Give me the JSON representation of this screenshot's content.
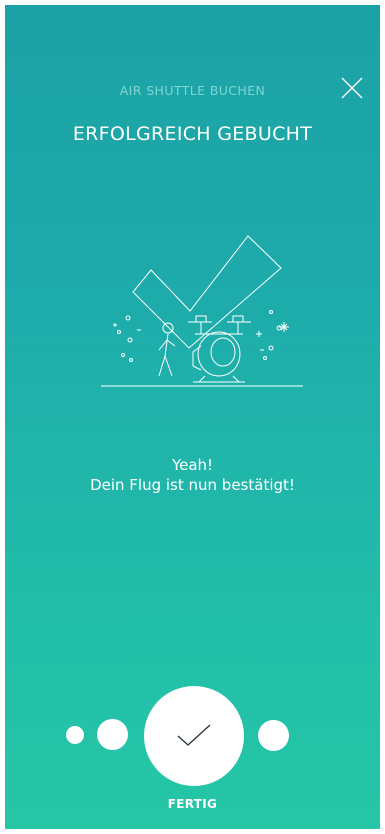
{
  "header": {
    "subtitle": "AIR SHUTTLE BUCHEN",
    "close_icon": "close-icon",
    "title": "ERFOLGREICH GEBUCHT"
  },
  "illustration": {
    "icon": "booking-success-illustration"
  },
  "message": {
    "line1": "Yeah!",
    "line2": "Dein Flug ist nun bestätigt!"
  },
  "progress": {
    "steps_total": 4,
    "current_step": 3
  },
  "finish": {
    "icon": "checkmark-icon",
    "label": "FERTIG"
  },
  "colors": {
    "gradient_top": "#1ba2a4",
    "gradient_bottom": "#25c6a6",
    "subtitle": "#7fd6d3",
    "foreground": "#ffffff"
  }
}
